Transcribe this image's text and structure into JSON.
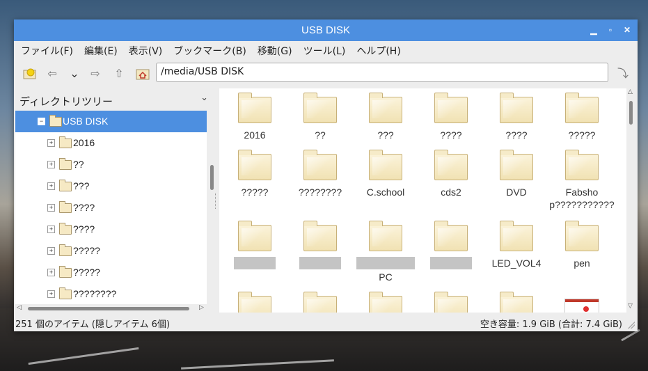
{
  "window": {
    "title": "USB DISK"
  },
  "menu": [
    "ファイル(F)",
    "編集(E)",
    "表示(V)",
    "ブックマーク(B)",
    "移動(G)",
    "ツール(L)",
    "ヘルプ(H)"
  ],
  "path": "/media/USB DISK",
  "sidebar": {
    "header": "ディレクトリツリー",
    "items": [
      {
        "label": "USB DISK",
        "expander": "−",
        "selected": true
      },
      {
        "label": "2016",
        "expander": "+"
      },
      {
        "label": "??",
        "expander": "+"
      },
      {
        "label": "???",
        "expander": "+"
      },
      {
        "label": "????",
        "expander": "+"
      },
      {
        "label": "????",
        "expander": "+"
      },
      {
        "label": "?????",
        "expander": "+"
      },
      {
        "label": "?????",
        "expander": "+"
      },
      {
        "label": "????????",
        "expander": "+"
      }
    ]
  },
  "files": [
    [
      "2016",
      "??",
      "???",
      "????",
      "????",
      "?????"
    ],
    [
      "?????",
      "????????",
      "C.school",
      "cds2",
      "DVD",
      "Fabshop???????????"
    ],
    [
      "",
      "",
      "PC",
      "",
      "LED_VOL4",
      "pen"
    ],
    [
      "",
      "",
      "",
      "",
      "",
      ""
    ]
  ],
  "status": {
    "left": "251 個のアイテム (隠しアイテム 6個)",
    "right": "空き容量: 1.9 GiB (合計: 7.4 GiB)"
  },
  "colors": {
    "titlebar": "#4d8fe0",
    "selection": "#4d8fe0",
    "folder": "#f1e2b3"
  }
}
